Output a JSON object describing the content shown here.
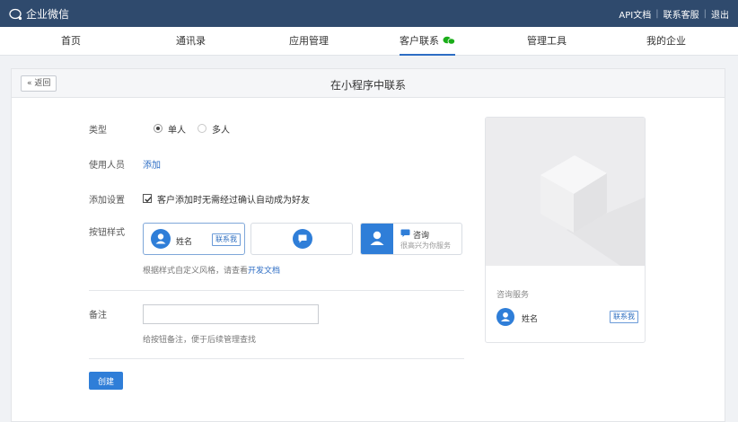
{
  "topbar": {
    "brand": "企业微信",
    "links": [
      "API文档",
      "联系客服",
      "退出"
    ]
  },
  "nav": {
    "items": [
      "首页",
      "通讯录",
      "应用管理",
      "客户联系",
      "管理工具",
      "我的企业"
    ],
    "active_index": 3
  },
  "panel": {
    "back_label": "返回",
    "title": "在小程序中联系"
  },
  "form": {
    "type_label": "类型",
    "type_options": [
      "单人",
      "多人"
    ],
    "type_selected": "单人",
    "users_label": "使用人员",
    "users_add": "添加",
    "add_setting_label": "添加设置",
    "add_setting_option": "客户添加时无需经过确认自动成为好友",
    "add_setting_checked": true,
    "button_style_label": "按钮样式",
    "card1_name": "姓名",
    "card1_tag": "联系我",
    "card3_title": "咨询",
    "card3_sub": "很高兴为你服务",
    "style_hint_prefix": "根据样式自定义风格，请查看",
    "style_hint_link": "开发文档",
    "note_label": "备注",
    "note_value": "",
    "note_hint": "给按钮备注，便于后续管理查找",
    "create_label": "创建"
  },
  "preview": {
    "section_label": "咨询服务",
    "name": "姓名",
    "tag": "联系我"
  },
  "colors": {
    "topbar": "#2f4a6d",
    "accent": "#2f7ed8",
    "wechat_green": "#1aad19"
  }
}
